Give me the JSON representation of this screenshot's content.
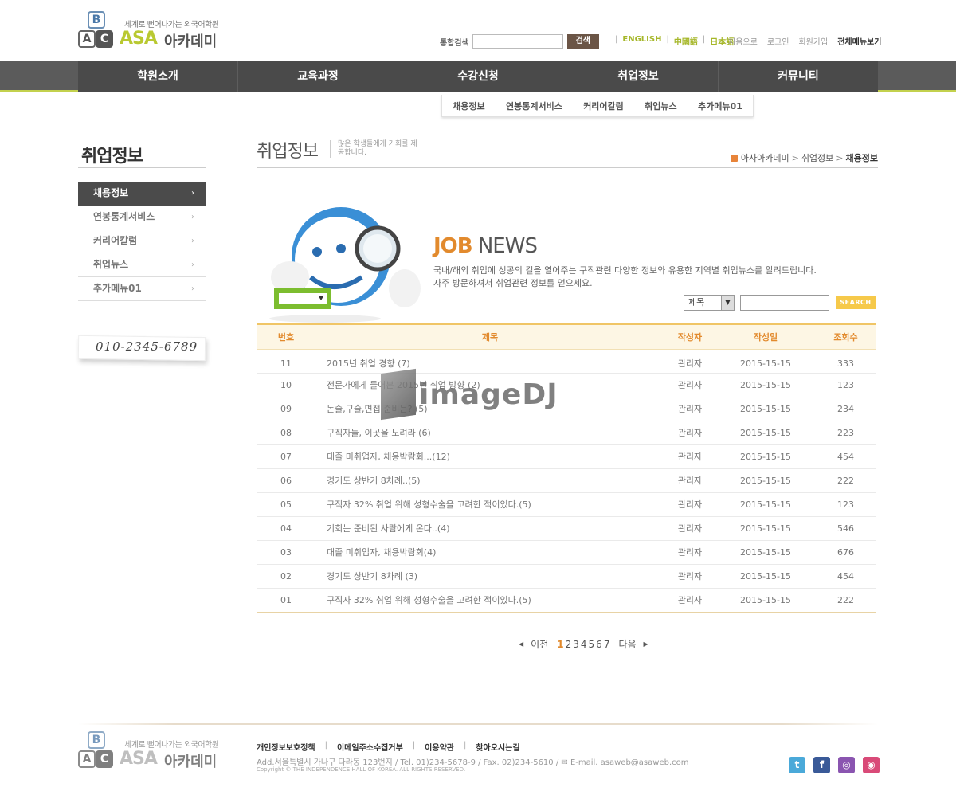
{
  "header": {
    "logo": {
      "sub": "세계로 뻗어나가는 외국어학원",
      "asa": "ASA",
      "brand": "아카데미",
      "blocks": [
        "B",
        "A",
        "C"
      ]
    },
    "search": {
      "label": "통합검색",
      "placeholder": "",
      "button": "검색"
    },
    "languages": [
      "ENGLISH",
      "中國語",
      "日本語"
    ],
    "util": [
      "처음으로",
      "로그인",
      "회원가입",
      "전체메뉴보기"
    ]
  },
  "gnb": [
    "학원소개",
    "교육과정",
    "수강신청",
    "취업정보",
    "커뮤니티"
  ],
  "subnav": [
    "채용정보",
    "연봉통계서비스",
    "커리어칼럼",
    "취업뉴스",
    "추가메뉴01"
  ],
  "lnb": {
    "title": "취업정보",
    "items": [
      "채용정보",
      "연봉통계서비스",
      "커리어칼럼",
      "취업뉴스",
      "추가메뉴01"
    ],
    "arrow": "›",
    "phone": "010-2345-6789"
  },
  "page": {
    "title": "취업정보",
    "desc": "많은 학생들에게 기회를 제공합니다.",
    "crumbs": [
      "아사아카데미",
      "취업정보",
      "채용정보"
    ],
    "crumb_sep": ">"
  },
  "jobnews": {
    "title_accent": "JOB",
    "title_rest": " NEWS",
    "desc1": "국내/해외 취업에 성공의 길을 열어주는 구직관련 다양한 정보와 유용한 지역별 취업뉴스를 알려드립니다.",
    "desc2": "자주 방문하셔서 취업관련 정보를 얻으세요."
  },
  "board_search": {
    "select": "제목",
    "dropdown": "▼",
    "button": "SEARCH",
    "placeholder": ""
  },
  "table": {
    "headers": [
      "번호",
      "제목",
      "작성자",
      "작성일",
      "조회수"
    ],
    "rows": [
      [
        "11",
        "2015년 취업 경향 (7)",
        "관리자",
        "2015-15-15",
        "333"
      ],
      [
        "10",
        "전문가에게 들어본 2015년 취업 방향 (2)",
        "관리자",
        "2015-15-15",
        "123"
      ],
      [
        "09",
        "논술,구술,면접 준비는? (5)",
        "관리자",
        "2015-15-15",
        "234"
      ],
      [
        "08",
        "구직자들, 이곳을 노려라 (6)",
        "관리자",
        "2015-15-15",
        "223"
      ],
      [
        "07",
        "대졸 미취업자, 채용박람회...(12)",
        "관리자",
        "2015-15-15",
        "454"
      ],
      [
        "06",
        "경기도 상반기 8차례..(5)",
        "관리자",
        "2015-15-15",
        "222"
      ],
      [
        "05",
        "구직자 32% 취업 위해 성형수술을 고려한 적이있다.(5)",
        "관리자",
        "2015-15-15",
        "123"
      ],
      [
        "04",
        "기회는 준비된 사람에게 온다..(4)",
        "관리자",
        "2015-15-15",
        "546"
      ],
      [
        "03",
        "대졸 미취업자, 채용박람회(4)",
        "관리자",
        "2015-15-15",
        "676"
      ],
      [
        "02",
        "경기도 상반기 8차례 (3)",
        "관리자",
        "2015-15-15",
        "454"
      ],
      [
        "01",
        "구직자 32% 취업 위해 성형수술을 고려한 적이있다.(5)",
        "관리자",
        "2015-15-15",
        "222"
      ]
    ]
  },
  "watermark": "imageDJ",
  "paging": {
    "prev": "이전",
    "next": "다음",
    "pages": [
      "1",
      "2",
      "3",
      "4",
      "5",
      "6",
      "7"
    ],
    "current": "1",
    "prev_arrow": "◀",
    "next_arrow": "▶"
  },
  "footer": {
    "links": [
      "개인정보보호정책",
      "이메일주소수집거부",
      "이용약관",
      "찾아오시는길"
    ],
    "address": "Add.서울특별시 가나구 다라동 123번지 / Tel. 01)234-5678-9 / Fax. 02)234-5610 / ✉ E-mail. asaweb@asaweb.com",
    "copyright": "Copyright © THE INDEPENDENCE HALL OF KOREA. ALL RIGHTS RESERVED.",
    "sns": [
      {
        "name": "twitter-icon",
        "glyph": "t",
        "color": "#4aa9d9"
      },
      {
        "name": "facebook-icon",
        "glyph": "f",
        "color": "#3a5a98"
      },
      {
        "name": "podcast-icon",
        "glyph": "◎",
        "color": "#8a55b0"
      },
      {
        "name": "instagram-icon",
        "glyph": "◉",
        "color": "#d94a78"
      }
    ]
  },
  "colors": {
    "accent": "#e28a2d",
    "lime": "#c3d14d",
    "nav": "#4a4a4a"
  }
}
